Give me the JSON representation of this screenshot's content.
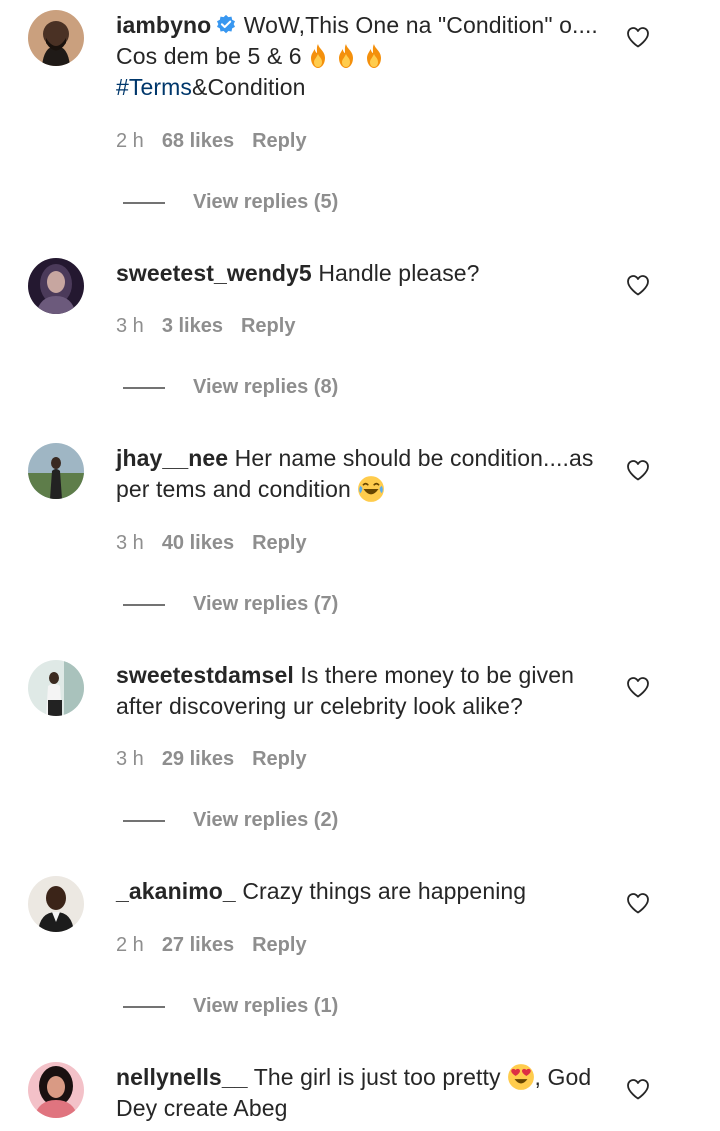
{
  "comments": [
    {
      "username": "iambyno",
      "verified": true,
      "text_parts": [
        "WoW,This One na \"Condition\" o.... Cos dem be 5 & 6",
        "#Terms",
        "&Condition"
      ],
      "emojis": [
        "fire-emoji",
        "fire-emoji",
        "fire-emoji"
      ],
      "time": "2 h",
      "likes": "68 likes",
      "reply": "Reply",
      "view_replies": "View replies (5)",
      "avatar_color": "#3b2a20"
    },
    {
      "username": "sweetest_wendy5",
      "text": "Handle please?",
      "time": "3 h",
      "likes": "3 likes",
      "reply": "Reply",
      "view_replies": "View replies (8)",
      "avatar_color": "#2a1d3a"
    },
    {
      "username": "jhay__nee",
      "text": "Her name should be condition....as per tems and condition",
      "emoji": "laughing-emoji",
      "time": "3 h",
      "likes": "40 likes",
      "reply": "Reply",
      "view_replies": "View replies (7)",
      "avatar_color": "#6b8a5e"
    },
    {
      "username": "sweetestdamsel",
      "text": "Is there money to be given after discovering ur celebrity look alike?",
      "time": "3 h",
      "likes": "29 likes",
      "reply": "Reply",
      "view_replies": "View replies (2)",
      "avatar_color": "#c9d7d2"
    },
    {
      "username": "_akanimo_",
      "text": "Crazy things are happening",
      "time": "2 h",
      "likes": "27 likes",
      "reply": "Reply",
      "view_replies": "View replies (1)",
      "avatar_color": "#e7e2dc"
    },
    {
      "username": "nellynells__",
      "text_before": "The girl is just too pretty",
      "emoji": "heart-eyes-emoji",
      "text_after": ", God Dey create Abeg",
      "avatar_color": "#e79aa5"
    }
  ],
  "colors": {
    "text": "#262626",
    "meta": "#8e8e8e",
    "hashtag": "#00376b",
    "verified": "#3897f0"
  },
  "icons": {
    "like": "heart-outline-icon",
    "verified": "verified-badge-icon"
  }
}
